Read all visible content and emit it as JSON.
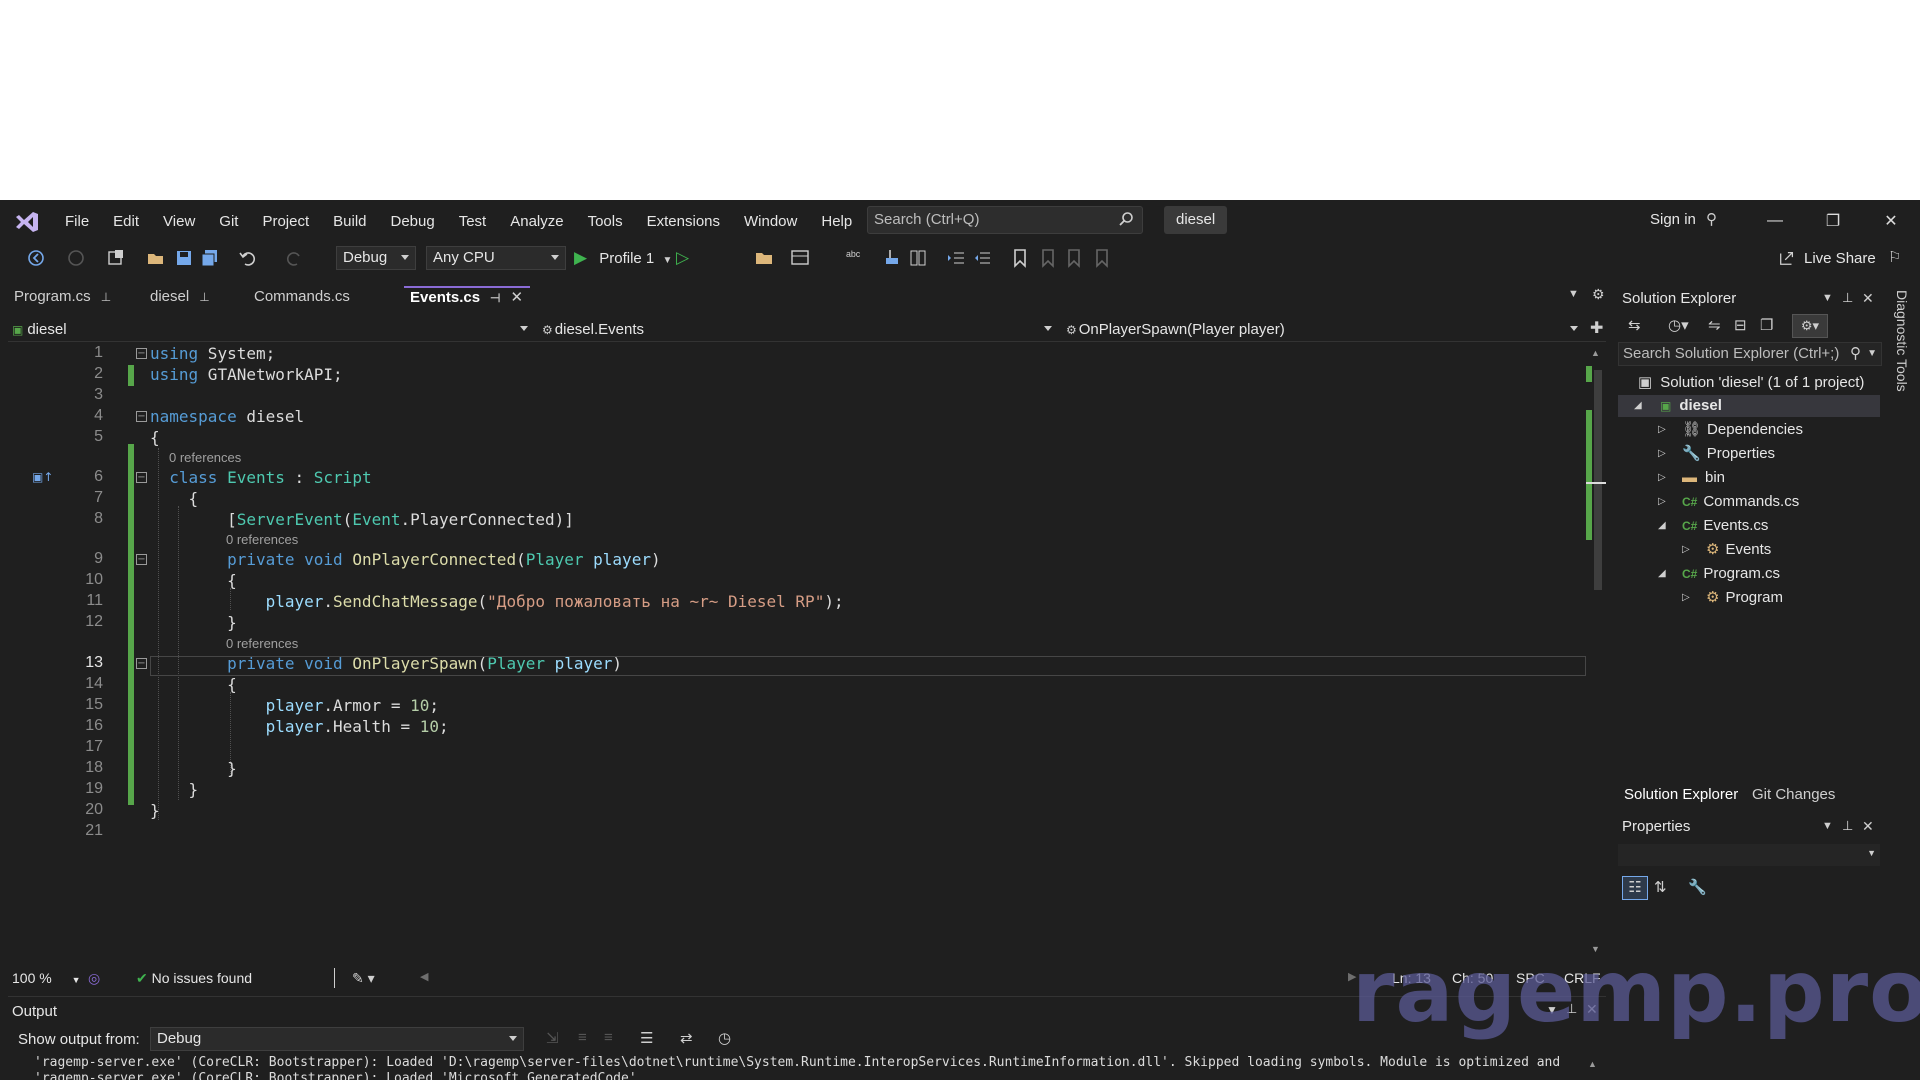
{
  "menu": [
    "File",
    "Edit",
    "View",
    "Git",
    "Project",
    "Build",
    "Debug",
    "Test",
    "Analyze",
    "Tools",
    "Extensions",
    "Window",
    "Help"
  ],
  "search": {
    "placeholder": "Search (Ctrl+Q)"
  },
  "solution_name": "diesel",
  "signin": "Sign in",
  "toolbar": {
    "config": "Debug",
    "platform": "Any CPU",
    "profile": "Profile 1",
    "liveshare": "Live Share"
  },
  "tabs": [
    {
      "label": "Program.cs"
    },
    {
      "label": "diesel"
    },
    {
      "label": "Commands.cs"
    },
    {
      "label": "Events.cs"
    }
  ],
  "navbar": {
    "project": "diesel",
    "class": "diesel.Events",
    "member": "OnPlayerSpawn(Player player)"
  },
  "editor": {
    "line_numbers": [
      "1",
      "2",
      "3",
      "4",
      "5",
      "6",
      "7",
      "8",
      "9",
      "10",
      "11",
      "12",
      "13",
      "14",
      "15",
      "16",
      "17",
      "18",
      "19",
      "20",
      "21"
    ],
    "codelens": "0 references",
    "lines": {
      "l1": "using System;",
      "l2": "using GTANetworkAPI;",
      "l4": "namespace diesel",
      "l11_string": "\"Добро пожаловать на ~r~ Diesel RP\"",
      "armor_val": "10",
      "health_val": "10"
    }
  },
  "status": {
    "zoom": "100 %",
    "issues": "No issues found",
    "ln": "Ln: 13",
    "ch": "Ch: 50",
    "spc": "SPC",
    "crlf": "CRLF"
  },
  "output": {
    "title": "Output",
    "show_from_label": "Show output from:",
    "show_from_value": "Debug",
    "line1": "'ragemp-server.exe' (CoreCLR: Bootstrapper): Loaded 'D:\\ragemp\\server-files\\dotnet\\runtime\\System.Runtime.InteropServices.RuntimeInformation.dll'. Skipped loading symbols. Module is optimized and",
    "line2": "'ragemp-server.exe' (CoreCLR: Bootstrapper): Loaded 'Microsoft.GeneratedCode'."
  },
  "solution_explorer": {
    "title": "Solution Explorer",
    "search": "Search Solution Explorer (Ctrl+;)",
    "items": [
      {
        "label": "Solution 'diesel' (1 of 1 project)"
      },
      {
        "label": "diesel"
      },
      {
        "label": "Dependencies"
      },
      {
        "label": "Properties"
      },
      {
        "label": "bin"
      },
      {
        "label": "Commands.cs"
      },
      {
        "label": "Events.cs"
      },
      {
        "label": "Events"
      },
      {
        "label": "Program.cs"
      },
      {
        "label": "Program"
      }
    ],
    "tab_solution": "Solution Explorer",
    "tab_git": "Git Changes"
  },
  "properties": {
    "title": "Properties"
  },
  "side_tab": "Diagnostic Tools",
  "watermark": "ragemp.pro",
  "colors": {
    "bg": "#1f1f1f",
    "accent": "#8a6bd6",
    "keyword": "#569cd6",
    "type": "#4ec9b0",
    "method": "#dcdcaa",
    "string": "#d69d85"
  }
}
